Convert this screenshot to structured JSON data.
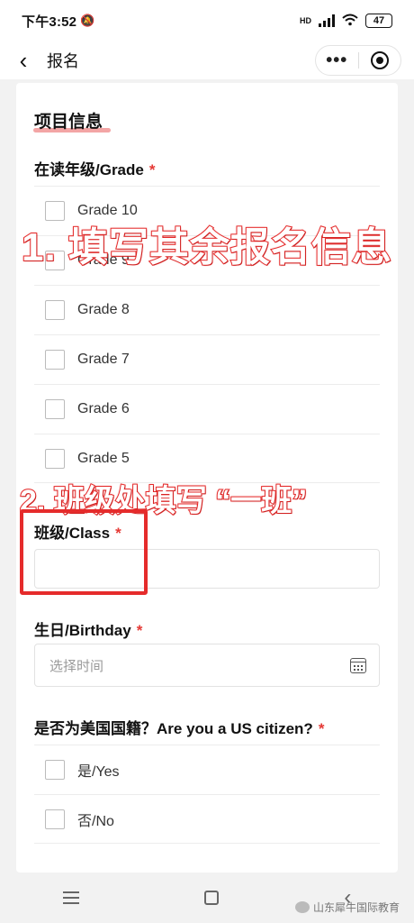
{
  "status_bar": {
    "time": "下午3:52",
    "mute_icon": "bell-mute-icon",
    "network": "HD",
    "battery": "47"
  },
  "nav": {
    "back_icon": "chevron-left-icon",
    "title": "报名",
    "more_icon": "more-dots-icon",
    "more_label": "•••",
    "target_icon": "circle-target-icon"
  },
  "form": {
    "section_title": "项目信息",
    "grade": {
      "label": "在读年级/Grade",
      "required": "*",
      "options": [
        "Grade 10",
        "Grade 9",
        "Grade 8",
        "Grade 7",
        "Grade 6",
        "Grade 5"
      ]
    },
    "class": {
      "label": "班级/Class",
      "required": "*",
      "value": ""
    },
    "birthday": {
      "label": "生日/Birthday",
      "required": "*",
      "placeholder": "选择时间"
    },
    "citizen": {
      "label": "是否为美国国籍？Are you a US citizen?",
      "required": "*",
      "options": [
        "是/Yes",
        "否/No"
      ]
    }
  },
  "annotations": {
    "step1": "1. 填写其余报名信息",
    "step2": "2. 班级处填写 “一班”"
  },
  "bottom_nav": {
    "menu_icon": "hamburger-menu-icon",
    "home_icon": "square-home-icon",
    "back_icon": "back-arrow-icon"
  },
  "watermark": "山东犀牛国际教育",
  "colors": {
    "required": "#e53935",
    "annotation": "#e52b2b",
    "title_underline": "#f3a5a5"
  }
}
